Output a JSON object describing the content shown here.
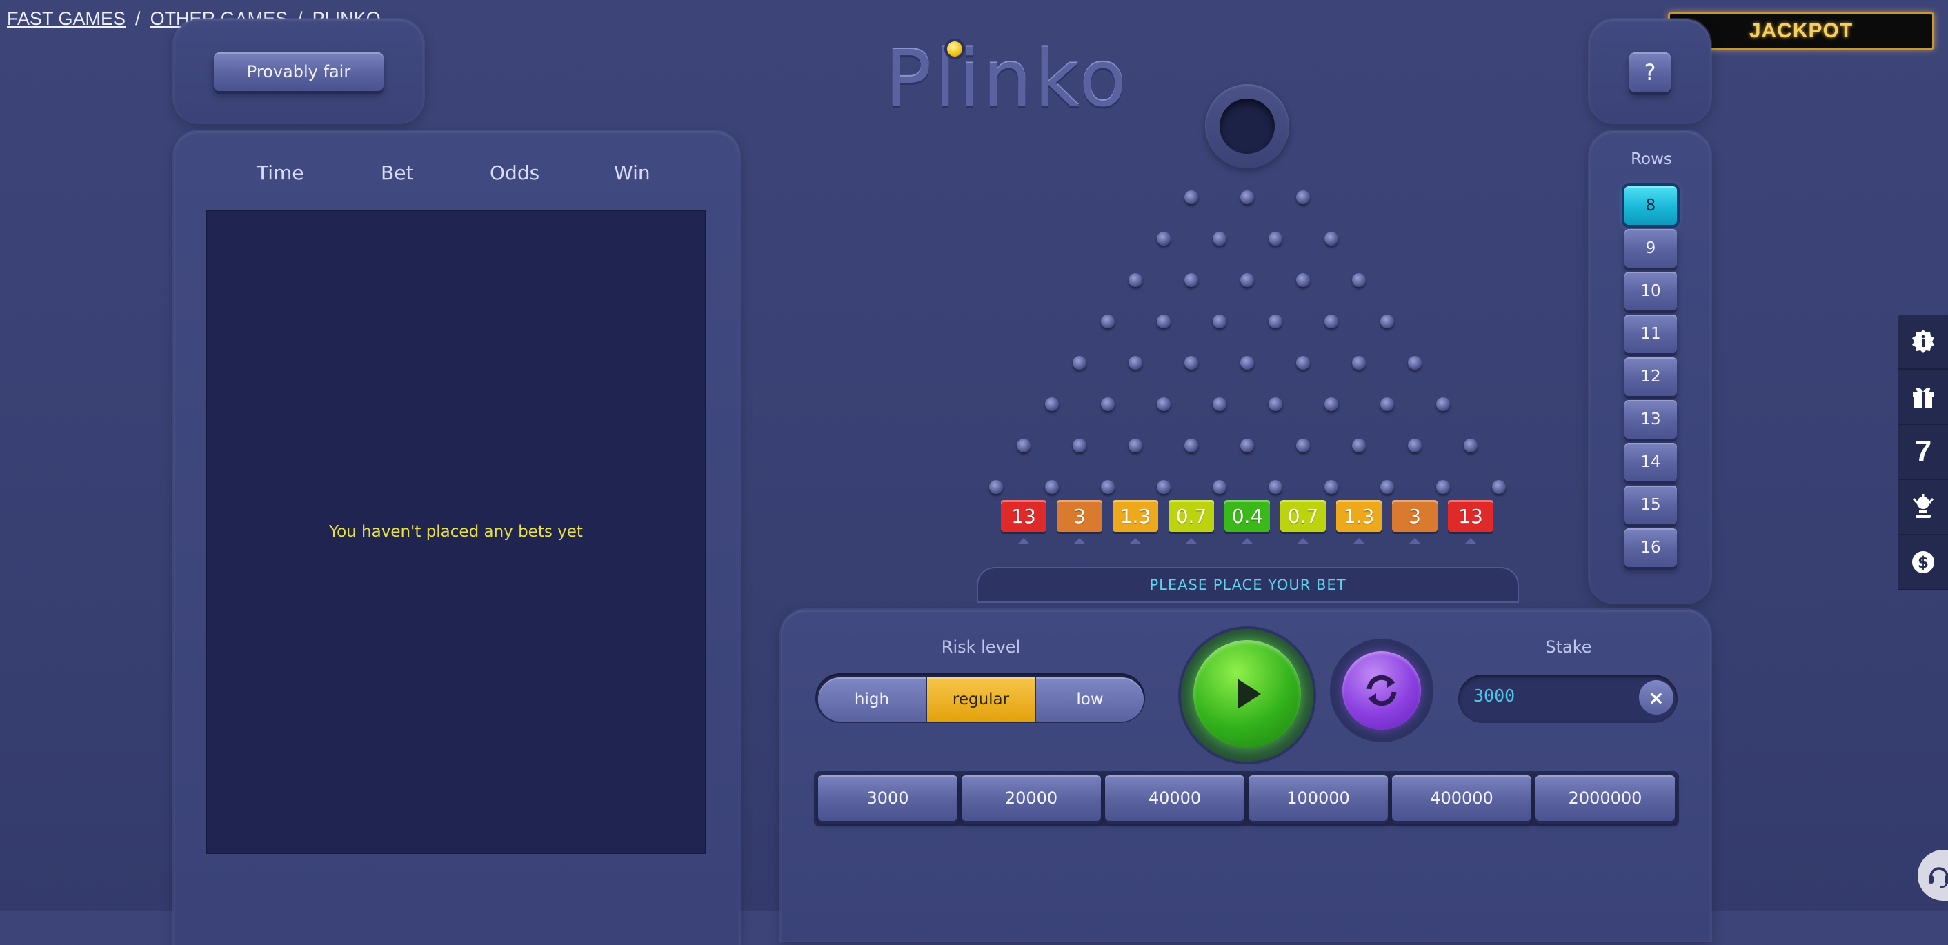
{
  "breadcrumb": [
    {
      "label": "FAST GAMES",
      "link": true
    },
    {
      "label": "OTHER GAMES",
      "link": true
    },
    {
      "label": "PLINKO",
      "link": false
    }
  ],
  "breadcrumb_separator": "/",
  "jackpot_label": "JACKPOT",
  "provably_fair_label": "Provably fair",
  "help_label": "?",
  "logo_text": "Plinko",
  "history": {
    "columns": [
      "Time",
      "Bet",
      "Odds",
      "Win"
    ],
    "empty_message": "You haven't placed any bets yet"
  },
  "rows": {
    "title": "Rows",
    "options": [
      "8",
      "9",
      "10",
      "11",
      "12",
      "13",
      "14",
      "15",
      "16"
    ],
    "selected": "8"
  },
  "board": {
    "multipliers": [
      "13",
      "3",
      "1.3",
      "0.7",
      "0.4",
      "0.7",
      "1.3",
      "3",
      "13"
    ],
    "multiplier_colors": [
      "#e02a2a",
      "#d97a2e",
      "#eda81c",
      "#bcd40e",
      "#3bb81a",
      "#bcd40e",
      "#eda81c",
      "#d97a2e",
      "#e02a2a"
    ]
  },
  "status_message": "PLEASE PLACE YOUR BET",
  "risk": {
    "title": "Risk level",
    "options": [
      "high",
      "regular",
      "low"
    ],
    "selected": "regular"
  },
  "stake": {
    "title": "Stake",
    "value": "3000",
    "clear_label": "×"
  },
  "quick_amounts": [
    "3000",
    "20000",
    "40000",
    "100000",
    "400000",
    "2000000"
  ],
  "side_icons": [
    "info-badge-icon",
    "gift-icon",
    "seven-icon",
    "trophy-icon",
    "dollar-icon"
  ],
  "side_seven": "7",
  "colors": {
    "accent_cyan": "#16b4d6",
    "play_green": "#33b21c",
    "refresh_purple": "#8b3fe0",
    "risk_selected": "#e3a10c",
    "empty_text": "#e9e04a"
  }
}
